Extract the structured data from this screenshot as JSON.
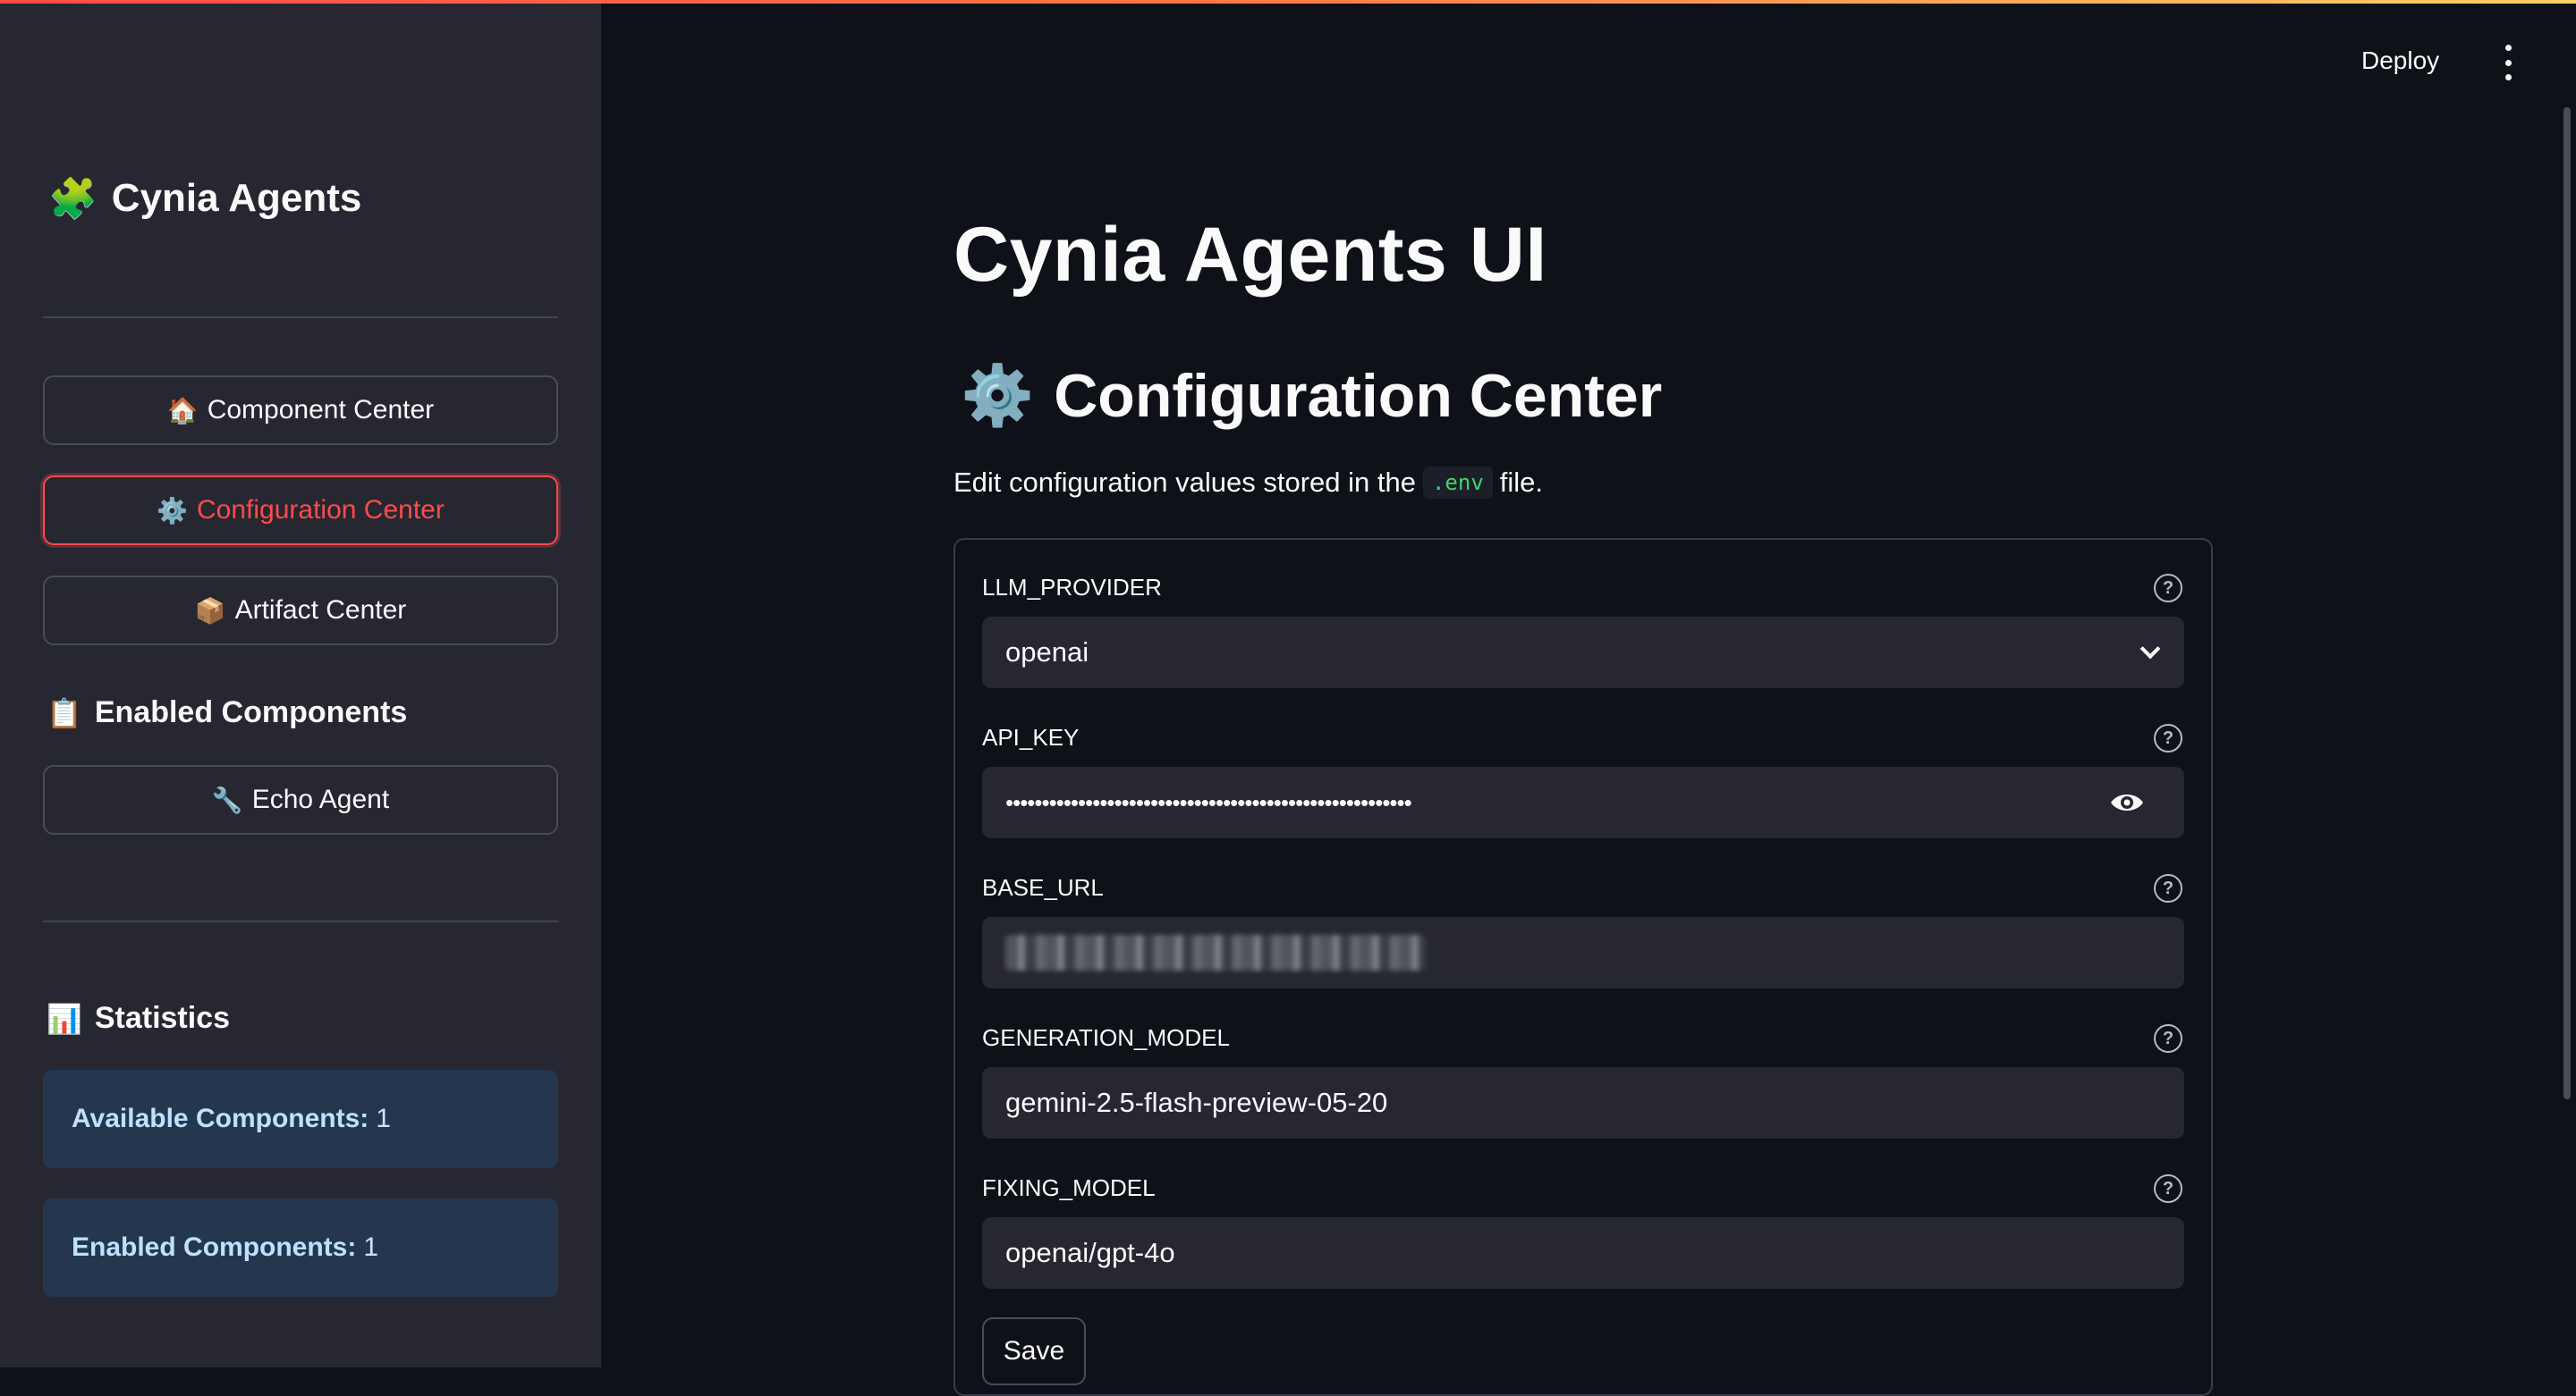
{
  "header": {
    "deploy_label": "Deploy"
  },
  "sidebar": {
    "brand": {
      "icon": "puzzle-piece-icon",
      "emoji": "🧩",
      "title": "Cynia Agents"
    },
    "nav": [
      {
        "emoji": "🏠",
        "label": "Component Center",
        "active": false
      },
      {
        "emoji": "⚙️",
        "label": "Configuration Center",
        "active": true
      },
      {
        "emoji": "📦",
        "label": "Artifact Center",
        "active": false
      }
    ],
    "enabled_section": {
      "emoji": "📋",
      "title": "Enabled Components"
    },
    "enabled_items": [
      {
        "emoji": "🔧",
        "label": "Echo Agent"
      }
    ],
    "stats_section": {
      "emoji": "📊",
      "title": "Statistics"
    },
    "stats": [
      {
        "label": "Available Components:",
        "value": "1"
      },
      {
        "label": "Enabled Components:",
        "value": "1"
      }
    ]
  },
  "main": {
    "title": "Cynia Agents UI",
    "subheader": {
      "emoji": "⚙️",
      "text": "Configuration Center"
    },
    "description": {
      "before": "Edit configuration values stored in the",
      "code": ".env",
      "after": "file."
    },
    "fields": [
      {
        "name": "LLM_PROVIDER",
        "value": "openai",
        "type": "select"
      },
      {
        "name": "API_KEY",
        "value": "••••••••••••••••••••••••••••••••••••••••••••••••••••••••",
        "type": "password"
      },
      {
        "name": "BASE_URL",
        "value": "",
        "type": "blurred"
      },
      {
        "name": "GENERATION_MODEL",
        "value": "gemini-2.5-flash-preview-05-20",
        "type": "text"
      },
      {
        "name": "FIXING_MODEL",
        "value": "openai/gpt-4o",
        "type": "text"
      }
    ],
    "save_label": "Save"
  },
  "colors": {
    "accent": "#ff4b4b",
    "app_bg": "#0e1117",
    "sidebar_bg": "#262730",
    "info_bg": "#24374f"
  }
}
